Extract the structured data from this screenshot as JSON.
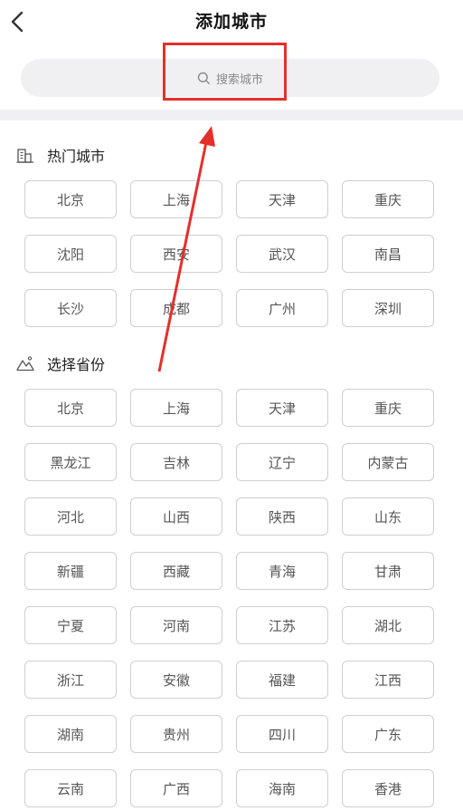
{
  "header": {
    "title": "添加城市",
    "back_icon": "chevron-left-icon"
  },
  "search": {
    "placeholder": "搜索城市",
    "icon": "search-icon"
  },
  "hot_cities": {
    "title": "热门城市",
    "icon": "buildings-icon",
    "items": [
      "北京",
      "上海",
      "天津",
      "重庆",
      "沈阳",
      "西安",
      "武汉",
      "南昌",
      "长沙",
      "成都",
      "广州",
      "深圳"
    ]
  },
  "provinces": {
    "title": "选择省份",
    "icon": "mountains-icon",
    "items": [
      "北京",
      "上海",
      "天津",
      "重庆",
      "黑龙江",
      "吉林",
      "辽宁",
      "内蒙古",
      "河北",
      "山西",
      "陕西",
      "山东",
      "新疆",
      "西藏",
      "青海",
      "甘肃",
      "宁夏",
      "河南",
      "江苏",
      "湖北",
      "浙江",
      "安徽",
      "福建",
      "江西",
      "湖南",
      "贵州",
      "四川",
      "广东",
      "云南",
      "广西",
      "海南",
      "香港"
    ]
  },
  "colors": {
    "annotation": "#e4302b",
    "chip_border": "#cfcfd4",
    "search_bg": "#f0f0f3"
  }
}
